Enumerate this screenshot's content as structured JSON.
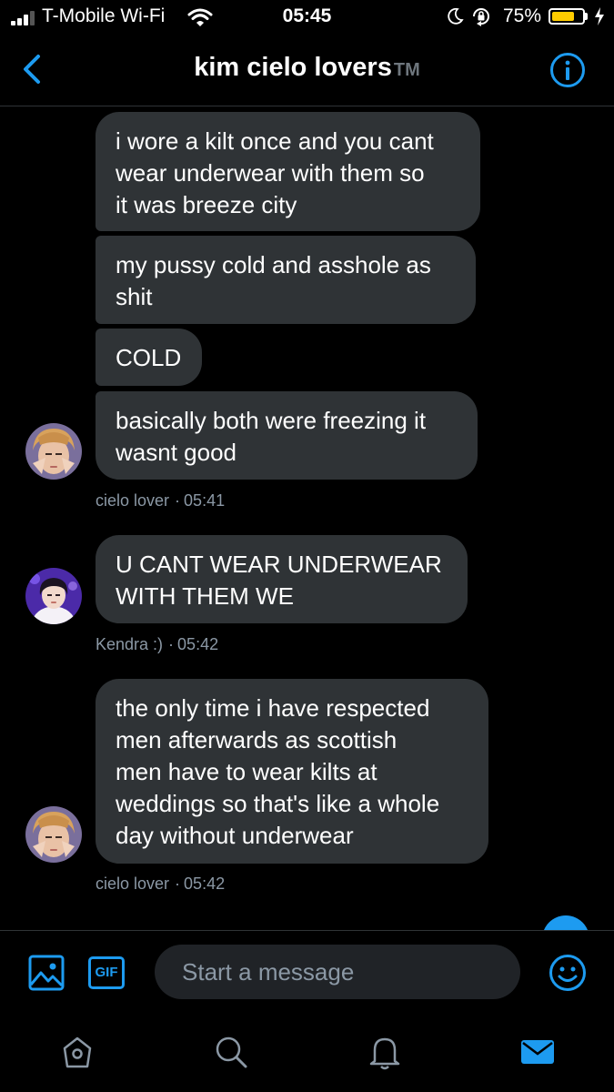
{
  "status_bar": {
    "carrier": "T-Mobile Wi-Fi",
    "time": "05:45",
    "battery_percent": "75%",
    "battery_level": 0.75,
    "icons": [
      "signal-icon",
      "wifi-icon",
      "moon-icon",
      "orientation-lock-icon",
      "battery-icon",
      "charging-icon"
    ]
  },
  "header": {
    "title": "kim cielo lovers",
    "title_suffix": "TM",
    "back_icon": "chevron-left-icon",
    "info_icon": "info-icon"
  },
  "messages": [
    {
      "group": "cielo lover",
      "bubbles": [
        {
          "lines": [
            "i wore a kilt once and you cant",
            "wear underwear with them so",
            "it was breeze city"
          ]
        },
        {
          "lines": [
            "my pussy cold and asshole as",
            "shit"
          ]
        },
        {
          "lines": [
            "COLD"
          ]
        },
        {
          "lines": [
            "basically both were freezing it",
            "wasnt good"
          ]
        }
      ],
      "sender": "cielo lover",
      "time": "05:41"
    },
    {
      "group": "Kendra",
      "bubbles": [
        {
          "lines": [
            "U CANT WEAR UNDERWEAR",
            "WITH THEM WE"
          ]
        }
      ],
      "sender": "Kendra :)",
      "time": "05:42"
    },
    {
      "group": "cielo lover",
      "bubbles": [
        {
          "lines": [
            "the only time i have respected",
            "men afterwards as scottish",
            "men have to wear kilts at",
            "weddings so that's like a whole",
            "day without underwear"
          ]
        }
      ],
      "sender": "cielo lover",
      "time": "05:42"
    }
  ],
  "meta_separator": "·",
  "composer": {
    "media_icon": "image-icon",
    "gif_label": "GIF",
    "placeholder": "Start a message",
    "emoji_icon": "emoji-icon"
  },
  "tab_bar": {
    "icons": [
      "home-icon",
      "search-icon",
      "notifications-icon",
      "messages-icon"
    ],
    "active": "messages-icon"
  },
  "colors": {
    "accent": "#1d9bf0",
    "bubble": "#2f3336",
    "muted_text": "#8b98a5",
    "battery": "#ffcc00"
  }
}
